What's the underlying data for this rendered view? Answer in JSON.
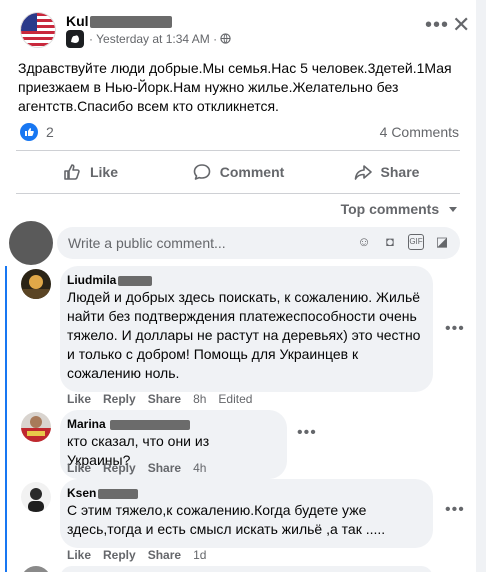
{
  "post": {
    "author": "Kul",
    "timestamp": "Yesterday at 1:34 AM",
    "separator": "·",
    "privacy_icon": "globe-icon",
    "text": "Здравствуйте люди добрые.Мы семья.Нас 5 человек.3детей.1Мая приезжаем в Нью-Йорк.Нам нужно жилье.Желательно без агентств.Спасибо всем кто откликнется.",
    "reaction_count": "2",
    "comments_count": "4 Comments"
  },
  "actions": {
    "like": "Like",
    "comment": "Comment",
    "share": "Share"
  },
  "comments_header": "Top comments",
  "composer": {
    "placeholder": "Write a public comment..."
  },
  "comments": [
    {
      "name": "Liudmila",
      "text": "Людей и добрых здесь поискать, к сожалению. Жильё найти без подтверждения платежеспособности очень тяжело. И доллары не растут на деревьях) это честно и только с добром! Помощь для Украинцев к сожалению ноль.",
      "like": "Like",
      "reply": "Reply",
      "share": "Share",
      "time": "8h",
      "edited": "Edited"
    },
    {
      "name": "Marina",
      "text": "кто сказал, что они из Украины?",
      "like": "Like",
      "reply": "Reply",
      "share": "Share",
      "time": "4h"
    },
    {
      "name": "Ksen",
      "text": "С этим тяжело,к сожалению.Когда будете уже здесь,тогда и есть смысл искать жильё ,а так .....",
      "like": "Like",
      "reply": "Reply",
      "share": "Share",
      "time": "1d"
    }
  ],
  "colors": {
    "accent": "#1877f2",
    "secondary_text": "#65676b",
    "bubble": "#f0f2f5"
  }
}
